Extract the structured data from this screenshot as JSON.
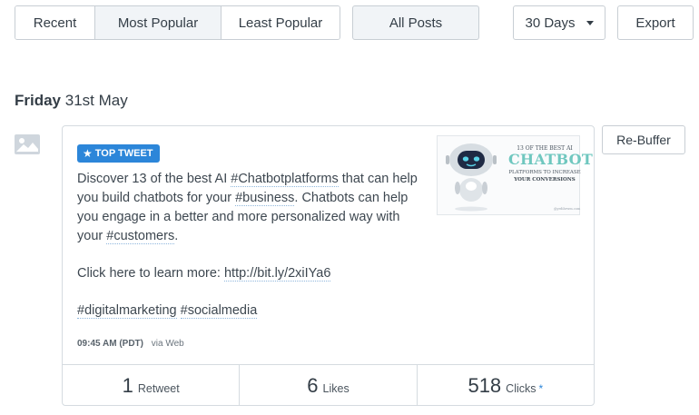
{
  "filters": {
    "sort_tabs": [
      {
        "label": "Recent",
        "active": false
      },
      {
        "label": "Most Popular",
        "active": true
      },
      {
        "label": "Least Popular",
        "active": false
      }
    ],
    "post_type": "All Posts",
    "range": "30 Days",
    "export_label": "Export"
  },
  "date_heading": {
    "day": "Friday",
    "date": "31st May"
  },
  "post": {
    "badge": "TOP TWEET",
    "text_line1_a": "Discover 13 of the best AI ",
    "tag_chatbot": "#Chatbotplatforms",
    "text_line1_b": " that can help you build chatbots for your ",
    "tag_business": "#business",
    "text_line1_c": ". Chatbots can help you engage in a better and more personalized way with your ",
    "tag_customers": "#customers",
    "text_line1_d": ".",
    "learn_more": "Click here to learn more: ",
    "link": "http://bit.ly/2xiIYa6",
    "tag_digital": "#digitalmarketing",
    "tag_social": "#socialmedia",
    "time": "09:45 AM (PDT)",
    "via": "via Web",
    "thumbnail": {
      "line1": "13 OF THE BEST AI",
      "line2": "CHATBOT",
      "line3": "PLATFORMS TO INCREASE",
      "line4": "YOUR CONVERSIONS",
      "credit": "@yrdibrwm.com"
    },
    "stats": {
      "retweets": {
        "value": "1",
        "label": "Retweet"
      },
      "likes": {
        "value": "6",
        "label": "Likes"
      },
      "clicks": {
        "value": "518",
        "label": "Clicks",
        "marker": "*"
      }
    },
    "rebuffer_label": "Re-Buffer"
  },
  "colors": {
    "accent": "#2c86d9",
    "active_tab": "#f1f4f7",
    "border": "#c8ced4"
  }
}
